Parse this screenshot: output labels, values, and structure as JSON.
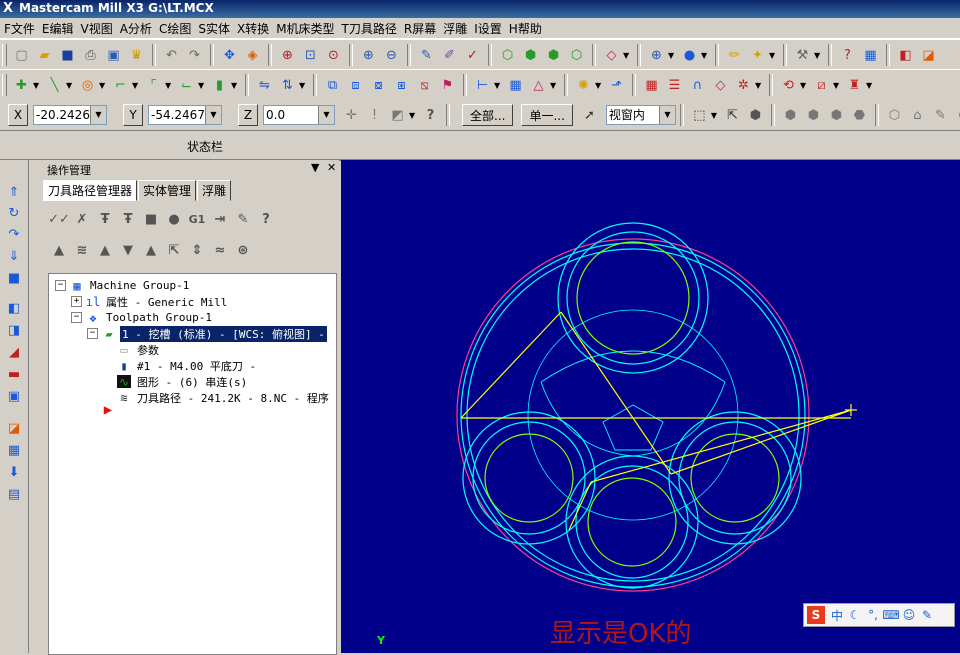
{
  "titlebar": {
    "title": "Mastercam Mill X3  G:\\LT.MCX"
  },
  "menu": [
    {
      "label": "F文件"
    },
    {
      "label": "E编辑"
    },
    {
      "label": "V视图"
    },
    {
      "label": "A分析"
    },
    {
      "label": "C绘图"
    },
    {
      "label": "S实体"
    },
    {
      "label": "X转换"
    },
    {
      "label": "M机床类型"
    },
    {
      "label": "T刀具路径"
    },
    {
      "label": "R屏幕"
    },
    {
      "label": "浮雕"
    },
    {
      "label": "I设置"
    },
    {
      "label": "H帮助"
    }
  ],
  "coordbar": {
    "x_label": "X",
    "x_value": "-20.24268",
    "y_label": "Y",
    "y_value": "-54.24678",
    "z_label": "Z",
    "z_value": "0.0",
    "select_all": "全部...",
    "select_single": "单一...",
    "view_mode": "视窗内"
  },
  "statusbar": {
    "label": "状态栏"
  },
  "ops_panel": {
    "title": "操作管理",
    "tabs": [
      {
        "label": "刀具路径管理器"
      },
      {
        "label": "实体管理"
      },
      {
        "label": "浮雕"
      }
    ],
    "tree": {
      "machine_group": "Machine Group-1",
      "properties": "属性 - Generic Mill",
      "toolpath_group": "Toolpath Group-1",
      "operation": "1 - 挖槽 (标准) - [WCS: 俯视图] -",
      "params": "参数",
      "tool": "#1 - M4.00 平底刀 -",
      "geometry": "图形 - (6) 串连(s)",
      "toolpath": "刀具路径 - 241.2K - 8.NC - 程序"
    }
  },
  "viewport": {
    "overlay_text": "显示是OK的",
    "axis_label": "Y"
  },
  "ime": {
    "logo": "S",
    "mode": "中"
  },
  "colors": {
    "viewport_bg": "#00008b",
    "geometry": "#00ffff",
    "circles_inner": "#80ff00",
    "outer_circle": "#ff3c8c",
    "toolpath_line": "#ffff00"
  }
}
